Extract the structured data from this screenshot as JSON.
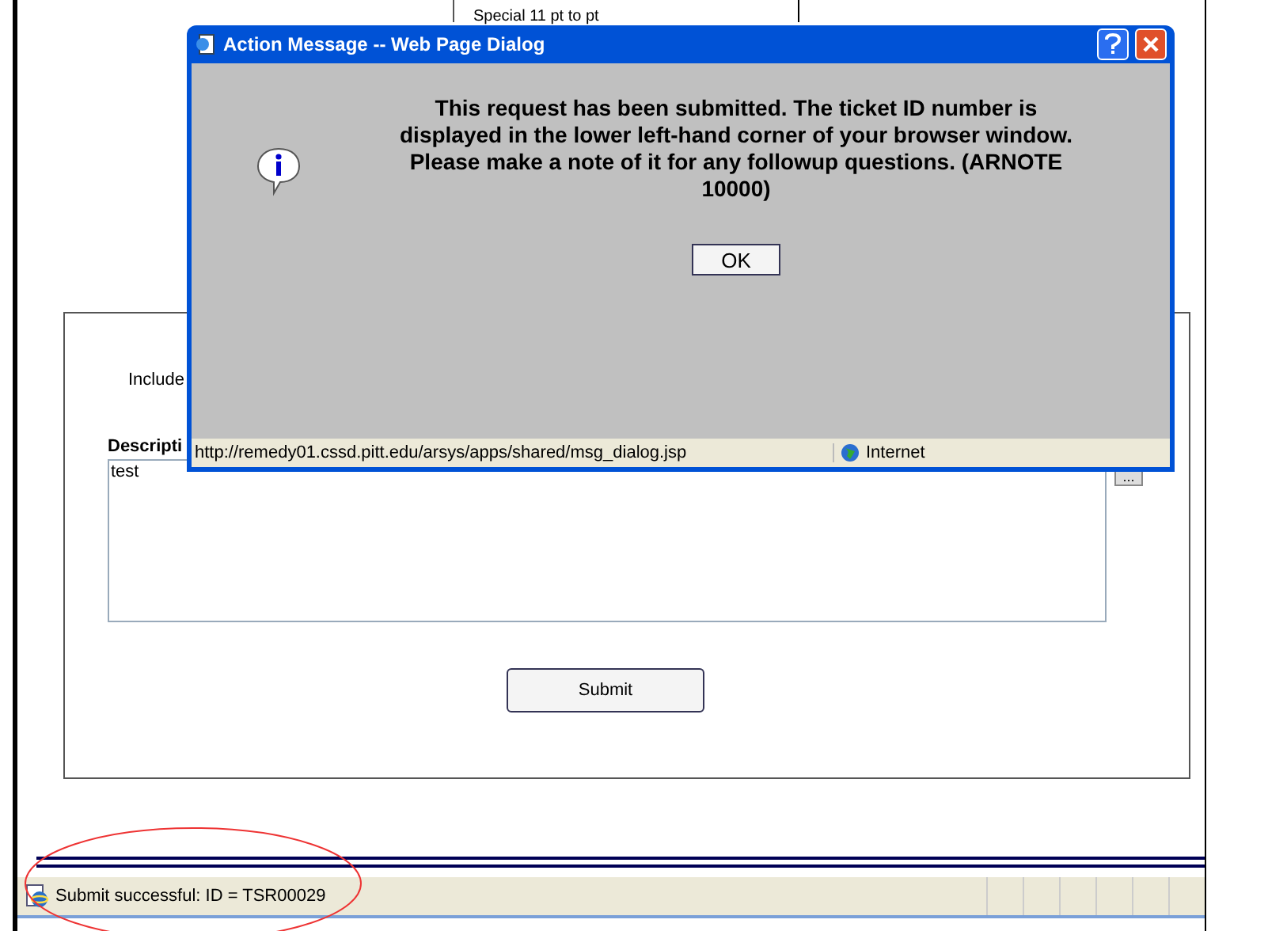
{
  "background_page": {
    "top_item": "Special 11 pt to pt",
    "include_label": "Include",
    "description_label": "Descripti",
    "description_value": "test",
    "more_button": "...",
    "submit_button": "Submit"
  },
  "dialog": {
    "title": "Action Message -- Web Page Dialog",
    "message": "This request has been submitted. The ticket ID number is displayed in the lower left-hand corner of your browser window. Please make a note of it for any followup questions. (ARNOTE 10000)",
    "ok_button": "OK",
    "status_url": "http://remedy01.cssd.pitt.edu/arsys/apps/shared/msg_dialog.jsp",
    "status_zone": "Internet"
  },
  "status_bar": {
    "text": "Submit successful: ID = TSR00029"
  }
}
